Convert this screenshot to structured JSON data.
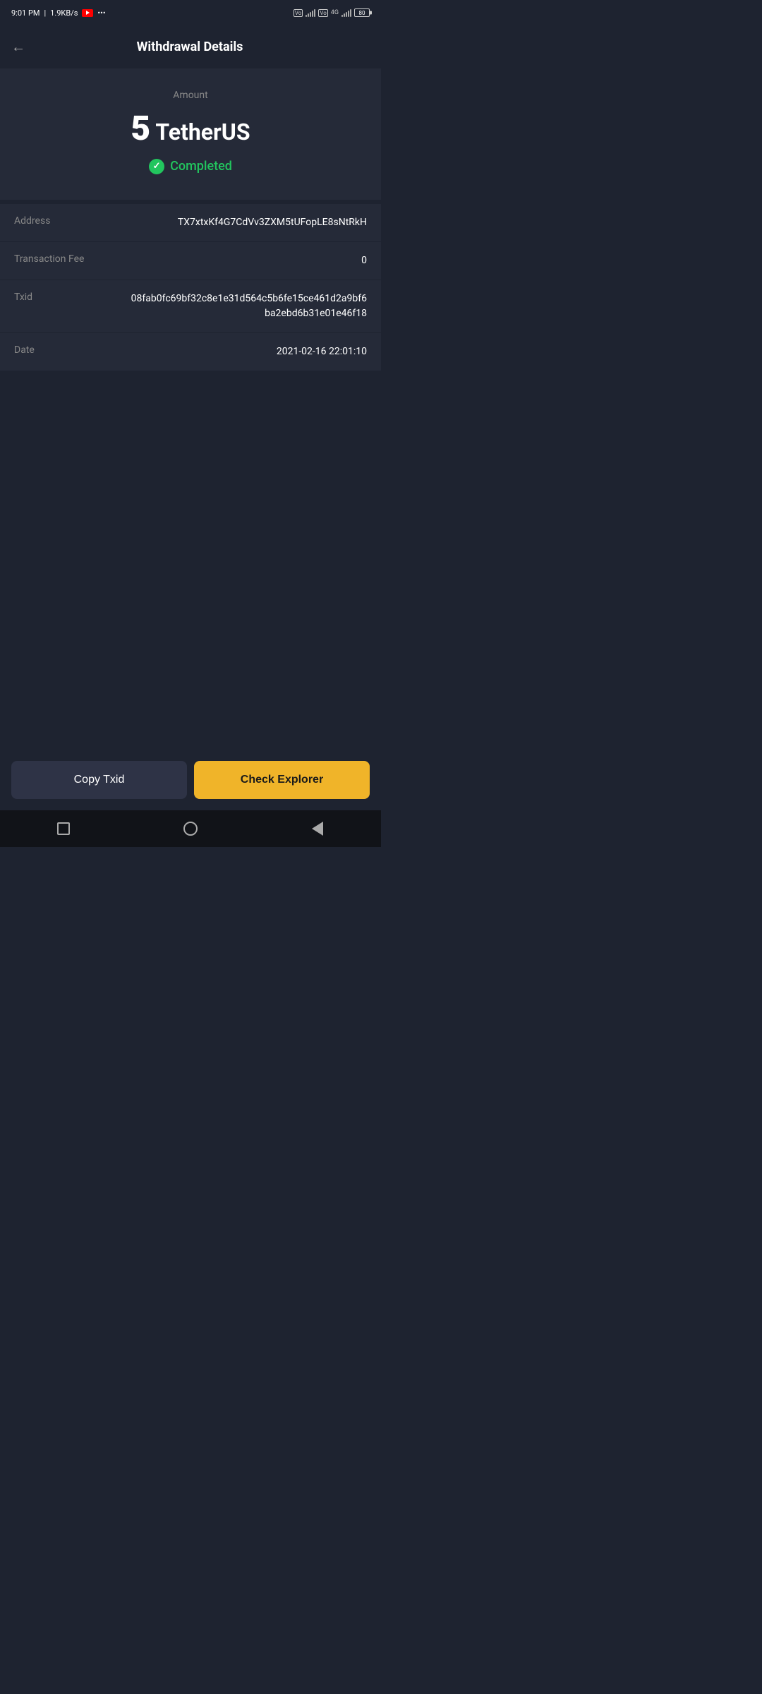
{
  "statusBar": {
    "time": "9:01 PM",
    "speed": "1.9KB/s",
    "batteryLevel": "80"
  },
  "header": {
    "title": "Withdrawal Details",
    "backLabel": "←"
  },
  "amountSection": {
    "label": "Amount",
    "amountNumber": "5",
    "amountCurrency": "TetherUS",
    "statusLabel": "Completed"
  },
  "details": [
    {
      "label": "Address",
      "value": "TX7xtxKf4G7CdVv3ZXM5tUFopLE8sNtRkH"
    },
    {
      "label": "Transaction Fee",
      "value": "0"
    },
    {
      "label": "Txid",
      "value": "08fab0fc69bf32c8e1e31d564c5b6fe15ce461d2a9bf6ba2ebd6b31e01e46f18"
    },
    {
      "label": "Date",
      "value": "2021-02-16 22:01:10"
    }
  ],
  "buttons": {
    "copyLabel": "Copy Txid",
    "explorerLabel": "Check Explorer"
  }
}
